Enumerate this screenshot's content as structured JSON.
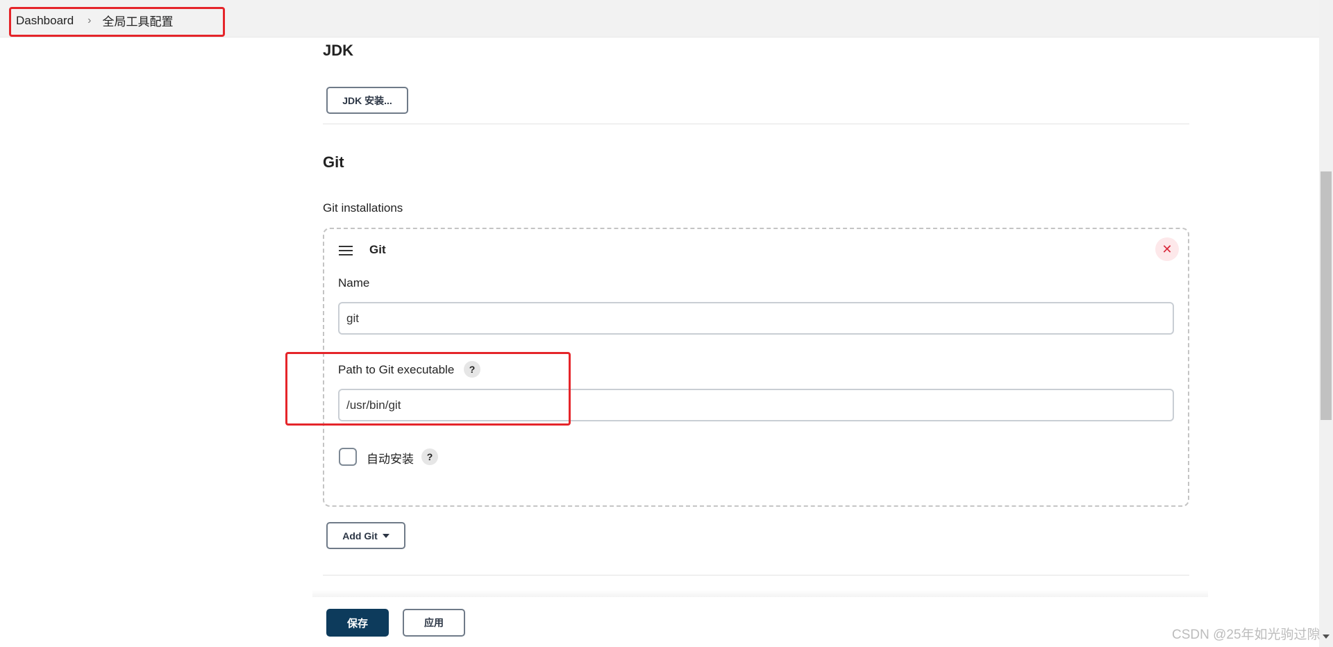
{
  "breadcrumb": {
    "items": [
      "Dashboard",
      "全局工具配置"
    ]
  },
  "jdk": {
    "title": "JDK",
    "install_button": "JDK 安装..."
  },
  "git": {
    "title": "Git",
    "installations_label": "Git installations",
    "card": {
      "title": "Git",
      "delete_glyph": "✕",
      "name_label": "Name",
      "name_value": "git",
      "path_label": "Path to Git executable",
      "path_value": "/usr/bin/git",
      "auto_install_label": "自动安装",
      "auto_install_checked": false,
      "help_glyph": "?"
    },
    "add_button": "Add Git"
  },
  "actions": {
    "save": "保存",
    "apply": "应用"
  },
  "watermark": "CSDN @25年如光驹过隙",
  "colors": {
    "highlight_red": "#e5252a",
    "primary_button": "#0d3b5c",
    "delete_bg": "#fde8ea",
    "delete_fg": "#d9283b"
  },
  "icons": {
    "breadcrumb_separator": "chevron-right-icon",
    "drag_handle": "drag-handle-icon",
    "delete": "close-icon",
    "help": "help-icon",
    "dropdown": "caret-down-icon"
  }
}
